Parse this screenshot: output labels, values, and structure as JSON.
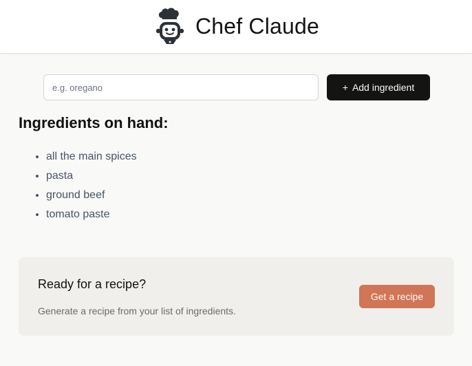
{
  "header": {
    "logo_icon": "chef-hat-robot-icon",
    "title": "Chef Claude"
  },
  "form": {
    "input_placeholder": "e.g. oregano",
    "input_value": "",
    "add_button_prefix": "+",
    "add_button_label": "Add ingredient"
  },
  "ingredients": {
    "heading": "Ingredients on hand:",
    "items": [
      "all the main spices",
      "pasta",
      "ground beef",
      "tomato paste"
    ]
  },
  "recipe_card": {
    "heading": "Ready for a recipe?",
    "description": "Generate a recipe from your list of ingredients.",
    "button_label": "Get a recipe"
  },
  "colors": {
    "accent_dark": "#141413",
    "recipe_button": "#d17557",
    "card_background": "#f0efeb",
    "page_background": "#f9f9f7"
  }
}
